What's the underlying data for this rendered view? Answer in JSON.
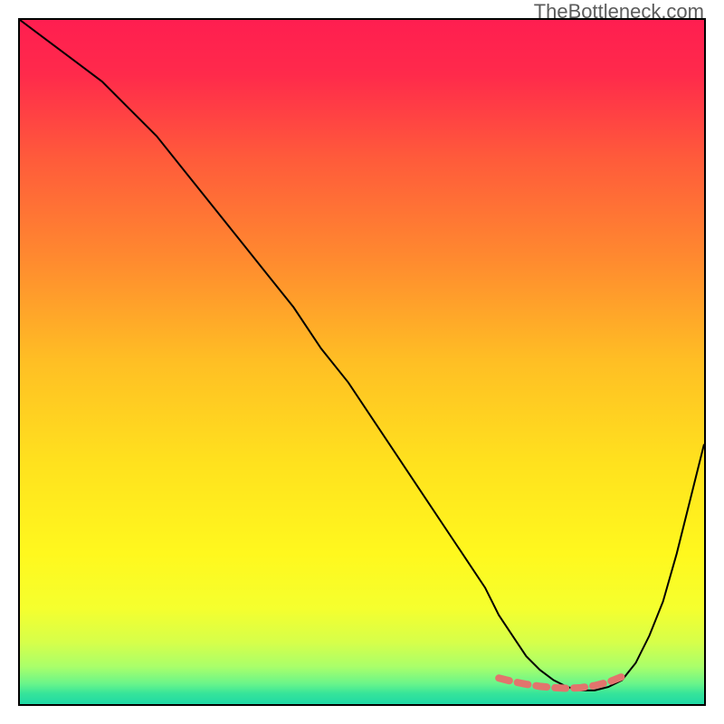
{
  "watermark": "TheBottleneck.com",
  "chart_data": {
    "type": "line",
    "title": "",
    "xlabel": "",
    "ylabel": "",
    "xlim": [
      0,
      100
    ],
    "ylim": [
      0,
      100
    ],
    "grid": false,
    "legend": false,
    "background_gradient_stops": [
      {
        "offset": 0.0,
        "color": "#ff1e50"
      },
      {
        "offset": 0.08,
        "color": "#ff2a4b"
      },
      {
        "offset": 0.2,
        "color": "#ff5a3b"
      },
      {
        "offset": 0.35,
        "color": "#ff8a2f"
      },
      {
        "offset": 0.5,
        "color": "#ffbf24"
      },
      {
        "offset": 0.65,
        "color": "#ffe21e"
      },
      {
        "offset": 0.78,
        "color": "#fff81e"
      },
      {
        "offset": 0.86,
        "color": "#f5ff2e"
      },
      {
        "offset": 0.91,
        "color": "#d6ff4a"
      },
      {
        "offset": 0.945,
        "color": "#aaff6a"
      },
      {
        "offset": 0.97,
        "color": "#6af58a"
      },
      {
        "offset": 0.985,
        "color": "#35e49a"
      },
      {
        "offset": 1.0,
        "color": "#1fd9a5"
      }
    ],
    "series": [
      {
        "name": "bottleneck-curve",
        "color": "#000000",
        "width": 2,
        "x": [
          0,
          4,
          8,
          12,
          16,
          20,
          24,
          28,
          32,
          36,
          40,
          44,
          48,
          52,
          56,
          60,
          64,
          68,
          70,
          72,
          74,
          76,
          78,
          80,
          82,
          84,
          86,
          88,
          90,
          92,
          94,
          96,
          98,
          100
        ],
        "y": [
          100,
          97,
          94,
          91,
          87,
          83,
          78,
          73,
          68,
          63,
          58,
          52,
          47,
          41,
          35,
          29,
          23,
          17,
          13,
          10,
          7,
          5,
          3.5,
          2.5,
          2.0,
          2.0,
          2.5,
          3.5,
          6,
          10,
          15,
          22,
          30,
          38
        ]
      },
      {
        "name": "optimal-range-marker",
        "color": "#e2746d",
        "width": 8,
        "dash": [
          12,
          9
        ],
        "x": [
          70,
          72,
          74,
          76,
          78,
          80,
          82,
          84,
          86,
          88
        ],
        "y": [
          3.8,
          3.3,
          2.9,
          2.6,
          2.4,
          2.3,
          2.4,
          2.7,
          3.2,
          4.0
        ]
      }
    ]
  }
}
